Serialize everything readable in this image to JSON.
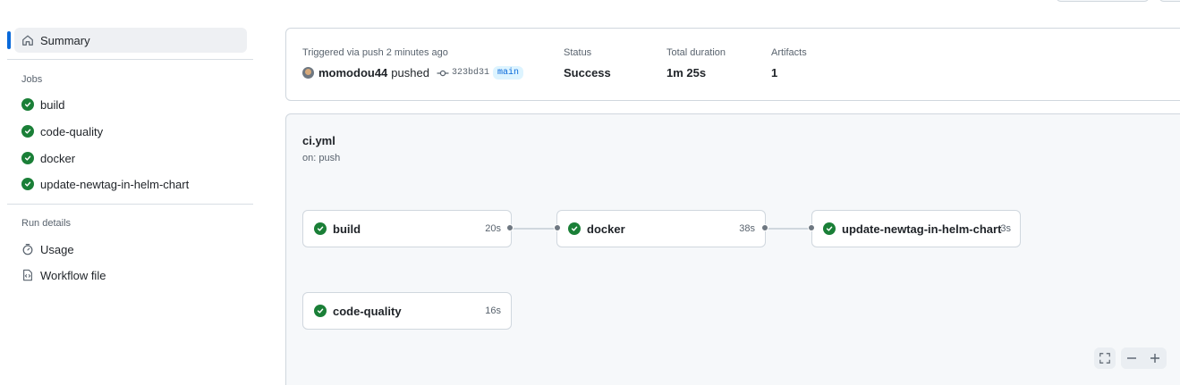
{
  "sidebar": {
    "summary_label": "Summary",
    "jobs_heading": "Jobs",
    "jobs": [
      {
        "label": "build",
        "status": "success"
      },
      {
        "label": "code-quality",
        "status": "success"
      },
      {
        "label": "docker",
        "status": "success"
      },
      {
        "label": "update-newtag-in-helm-chart",
        "status": "success"
      }
    ],
    "run_details_heading": "Run details",
    "usage_label": "Usage",
    "workflow_file_label": "Workflow file"
  },
  "summary": {
    "triggered_label": "Triggered via push 2 minutes ago",
    "actor": "momodou44",
    "action": "pushed",
    "commit_sha": "323bd31",
    "branch": "main",
    "status_label": "Status",
    "status_value": "Success",
    "duration_label": "Total duration",
    "duration_value": "1m 25s",
    "artifacts_label": "Artifacts",
    "artifacts_value": "1"
  },
  "workflow": {
    "file": "ci.yml",
    "trigger": "on: push",
    "jobs": [
      {
        "name": "build",
        "duration": "20s"
      },
      {
        "name": "docker",
        "duration": "38s"
      },
      {
        "name": "update-newtag-in-helm-chart",
        "duration": "3s"
      },
      {
        "name": "code-quality",
        "duration": "16s"
      }
    ]
  },
  "colors": {
    "success": "#1a7f37",
    "accent": "#0969da",
    "muted": "#59636e"
  }
}
